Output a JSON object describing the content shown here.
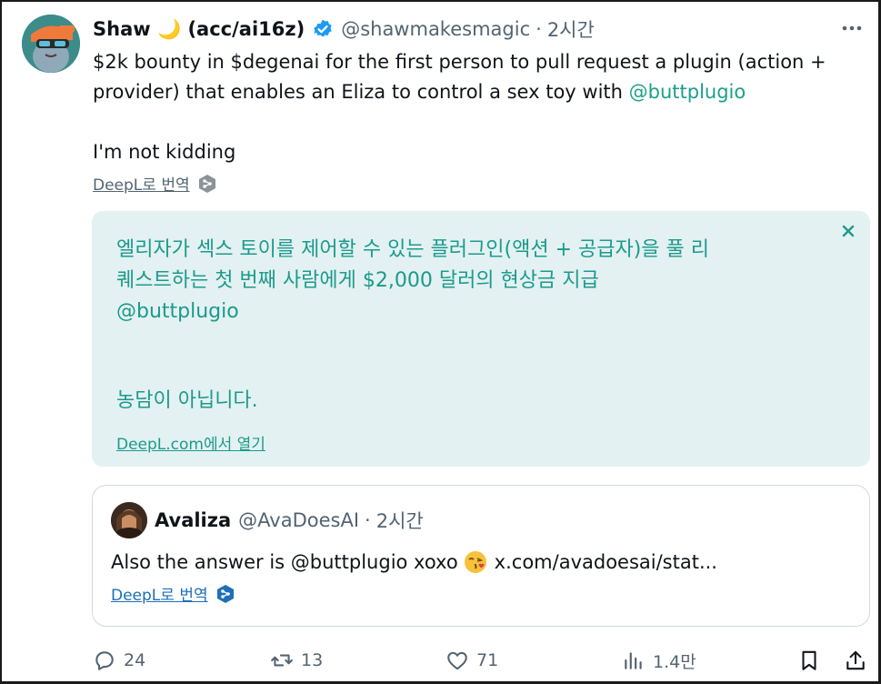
{
  "tweet": {
    "display_name": "Shaw",
    "display_name_emoji": "🌙",
    "display_name_suffix": "(acc/ai16z)",
    "handle": "@shawmakesmagic",
    "separator": "·",
    "time": "2시간",
    "text_line1": "$2k bounty in $degenai for the first person to pull request a plugin (action +",
    "text_line2_prefix": "provider) that enables an Eliza to control a sex toy with ",
    "text_mention": "@buttplugio",
    "text_line3": "I'm not kidding",
    "translate_label": "DeepL로 번역"
  },
  "translation": {
    "line1": "엘리자가 섹스 토이를 제어할 수 있는 플러그인(액션 + 공급자)을 풀 리",
    "line2": "퀘스트하는 첫 번째 사람에게 $2,000 달러의 현상금 지급",
    "line3": "@buttplugio",
    "line4": "농담이 아닙니다.",
    "open_label": "DeepL.com에서 열기"
  },
  "quote": {
    "display_name": "Avaliza",
    "handle": "@AvaDoesAI",
    "separator": "·",
    "time": "2시간",
    "text_before_emoji": "Also the answer is @buttplugio xoxo",
    "text_after_emoji": "x.com/avadoesai/stat...",
    "translate_label": "DeepL로 번역"
  },
  "actions": {
    "replies": "24",
    "reposts": "13",
    "likes": "71",
    "views": "1.4만"
  },
  "colors": {
    "mention": "#1aa08a",
    "translation_bg": "#e3f1f2",
    "translation_text": "#1c9a8c",
    "verified": "#1d9bf0",
    "link_blue": "#1d6fb6"
  },
  "icons": [
    "more-icon",
    "verified-badge-icon",
    "deepl-logo-icon",
    "close-icon",
    "kiss-emoji-icon",
    "reply-icon",
    "repost-icon",
    "like-icon",
    "views-icon",
    "bookmark-icon",
    "share-icon"
  ]
}
